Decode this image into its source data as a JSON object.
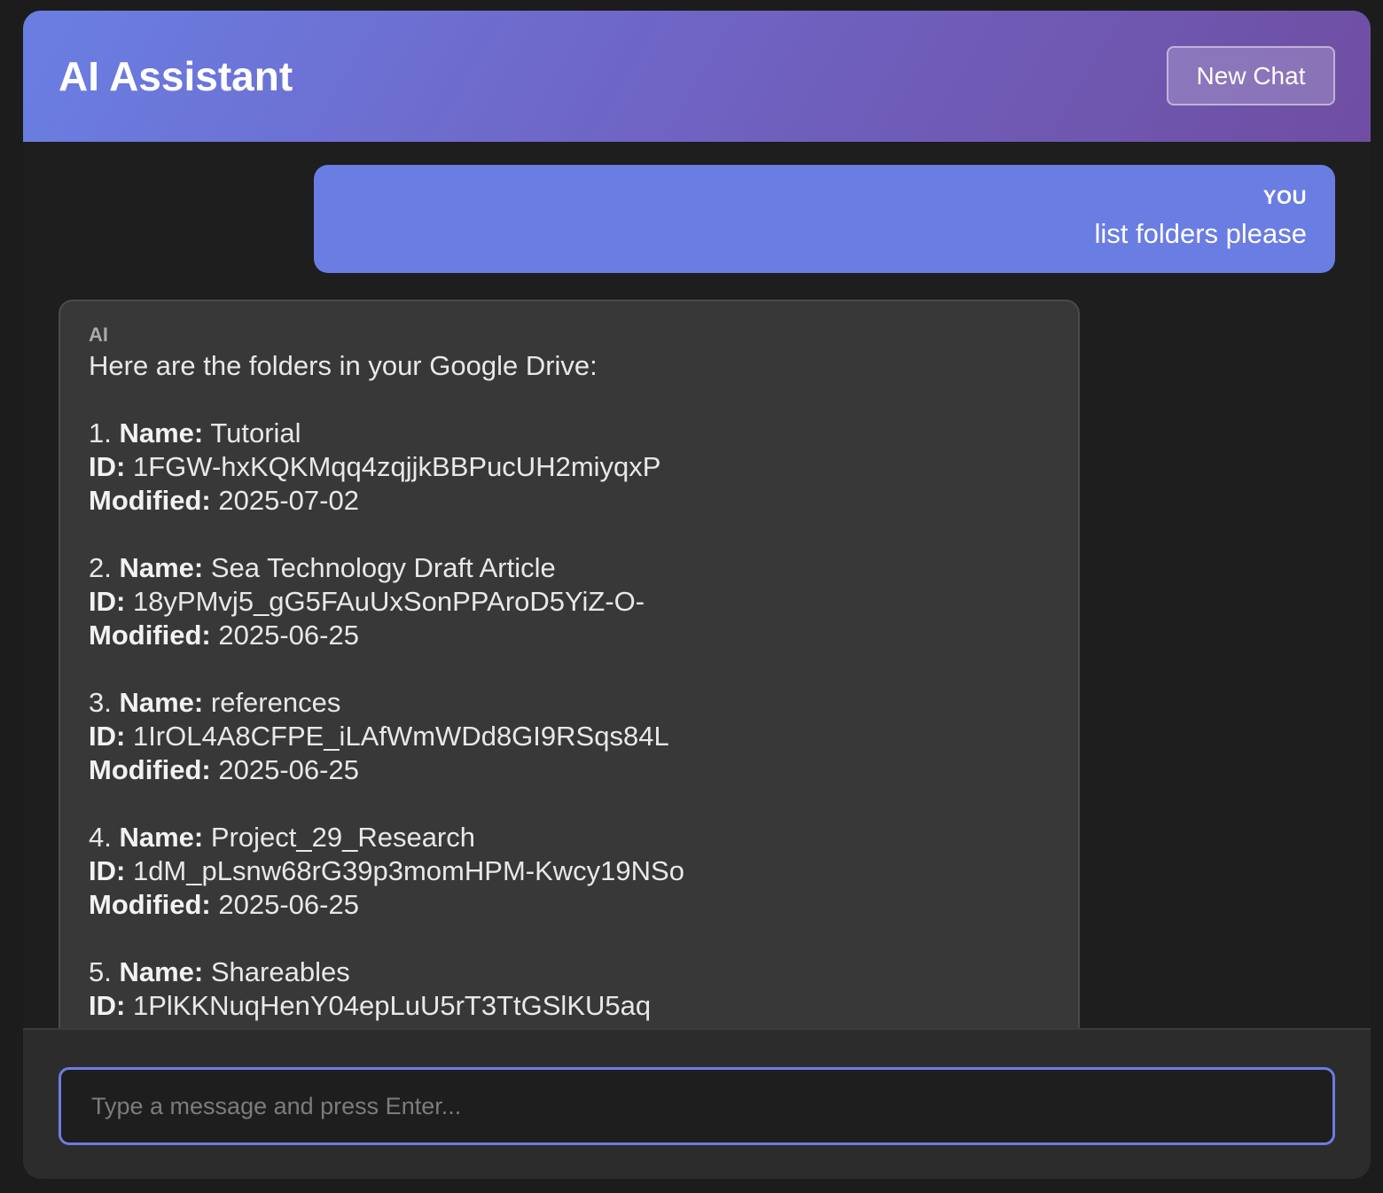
{
  "header": {
    "title": "AI Assistant",
    "new_chat_label": "New Chat"
  },
  "messages": {
    "user": {
      "sender": "YOU",
      "text": "list folders please"
    },
    "ai": {
      "sender": "AI",
      "intro": "Here are the folders in your Google Drive:",
      "name_label": "Name:",
      "id_label": "ID:",
      "modified_label": "Modified:",
      "folders": [
        {
          "num": "1.",
          "name": "Tutorial",
          "id": "1FGW-hxKQKMqq4zqjjkBBPucUH2miyqxP",
          "modified": "2025-07-02"
        },
        {
          "num": "2.",
          "name": "Sea Technology Draft Article",
          "id": "18yPMvj5_gG5FAuUxSonPPAroD5YiZ-O-",
          "modified": "2025-06-25"
        },
        {
          "num": "3.",
          "name": "references",
          "id": "1IrOL4A8CFPE_iLAfWmWDd8GI9RSqs84L",
          "modified": "2025-06-25"
        },
        {
          "num": "4.",
          "name": "Project_29_Research",
          "id": "1dM_pLsnw68rG39p3momHPM-Kwcy19NSo",
          "modified": "2025-06-25"
        },
        {
          "num": "5.",
          "name": "Shareables",
          "id": "1PlKKNuqHenY04epLuU5rT3TtGSlKU5aq",
          "modified": ""
        }
      ]
    }
  },
  "input": {
    "placeholder": "Type a message and press Enter...",
    "value": ""
  },
  "colors": {
    "accent": "#6a7de2",
    "header_gradient_start": "#6a7fe3",
    "header_gradient_end": "#6f4ea2",
    "ai_bubble": "#383838",
    "background": "#1e1e1e"
  }
}
